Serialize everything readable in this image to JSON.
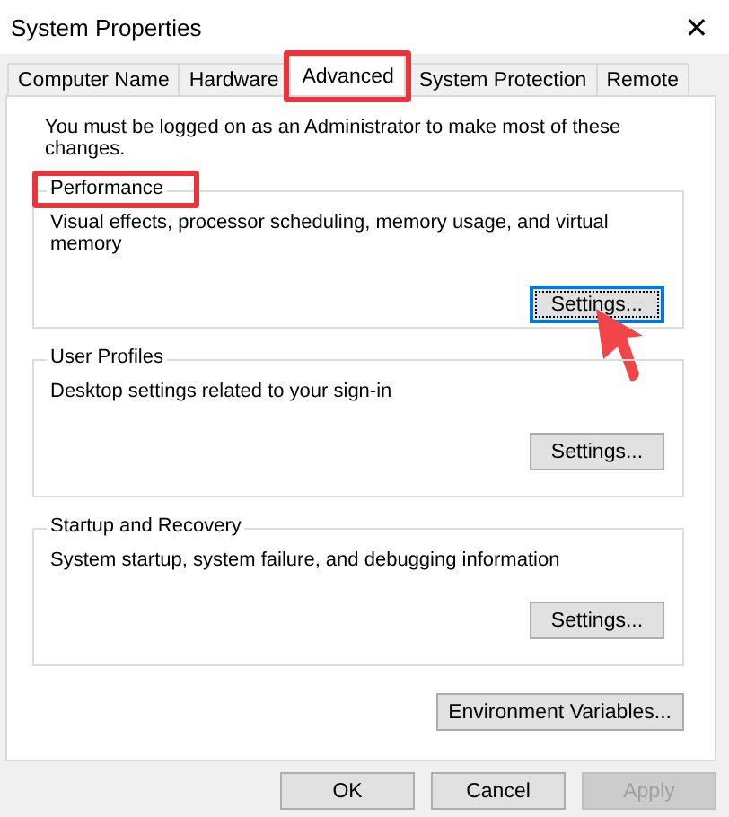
{
  "window": {
    "title": "System Properties",
    "close": "✕"
  },
  "tabs": [
    {
      "label": "Computer Name",
      "selected": false,
      "highlighted": false
    },
    {
      "label": "Hardware",
      "selected": false,
      "highlighted": false
    },
    {
      "label": "Advanced",
      "selected": true,
      "highlighted": true
    },
    {
      "label": "System Protection",
      "selected": false,
      "highlighted": false
    },
    {
      "label": "Remote",
      "selected": false,
      "highlighted": false
    }
  ],
  "notice": "You must be logged on as an Administrator to make most of these changes.",
  "groups": [
    {
      "title": "Performance",
      "description": "Visual effects, processor scheduling, memory usage, and virtual memory",
      "button": "Settings...",
      "focused": true,
      "highlighted": true,
      "pointed": true
    },
    {
      "title": "User Profiles",
      "description": "Desktop settings related to your sign-in",
      "button": "Settings...",
      "focused": false,
      "highlighted": false,
      "pointed": false
    },
    {
      "title": "Startup and Recovery",
      "description": "System startup, system failure, and debugging information",
      "button": "Settings...",
      "focused": false,
      "highlighted": false,
      "pointed": false
    }
  ],
  "environment_button": "Environment Variables...",
  "buttons": [
    {
      "label": "OK",
      "disabled": false
    },
    {
      "label": "Cancel",
      "disabled": false
    },
    {
      "label": "Apply",
      "disabled": true
    }
  ]
}
